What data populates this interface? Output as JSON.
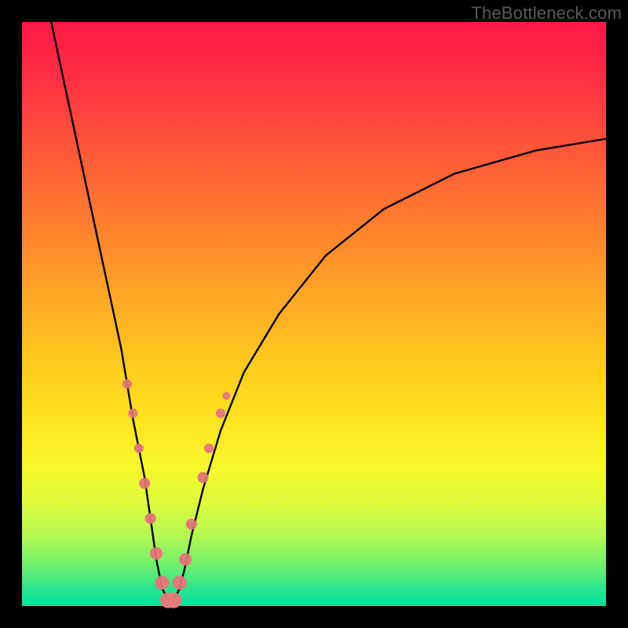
{
  "watermark": "TheBottleneck.com",
  "colors": {
    "frame": "#000000",
    "marker": "#e37a7a",
    "curve": "#000000"
  },
  "chart_data": {
    "type": "line",
    "title": "",
    "xlabel": "",
    "ylabel": "",
    "xlim": [
      0,
      100
    ],
    "ylim": [
      0,
      100
    ],
    "minimum_at_x": 25,
    "series": [
      {
        "name": "bottleneck-curve",
        "x": [
          5,
          8,
          11,
          14,
          17,
          19,
          21,
          22,
          23,
          24,
          25,
          26,
          27,
          28,
          29,
          31,
          34,
          38,
          44,
          52,
          62,
          74,
          88,
          100
        ],
        "y": [
          100,
          86,
          72,
          58,
          44,
          32,
          22,
          15,
          8,
          3,
          1,
          1,
          3,
          7,
          12,
          20,
          30,
          40,
          50,
          60,
          68,
          74,
          78,
          80
        ]
      }
    ],
    "markers": {
      "name": "highlighted-points",
      "radius_px_range": [
        4,
        10
      ],
      "points": [
        {
          "x": 18,
          "y": 38,
          "r": 6
        },
        {
          "x": 19,
          "y": 33,
          "r": 6
        },
        {
          "x": 20,
          "y": 27,
          "r": 6
        },
        {
          "x": 21,
          "y": 21,
          "r": 7
        },
        {
          "x": 22,
          "y": 15,
          "r": 7
        },
        {
          "x": 23,
          "y": 9,
          "r": 8
        },
        {
          "x": 24,
          "y": 4,
          "r": 9
        },
        {
          "x": 25,
          "y": 1,
          "r": 10
        },
        {
          "x": 26,
          "y": 1,
          "r": 10
        },
        {
          "x": 27,
          "y": 4,
          "r": 9
        },
        {
          "x": 28,
          "y": 8,
          "r": 8
        },
        {
          "x": 29,
          "y": 14,
          "r": 7
        },
        {
          "x": 31,
          "y": 22,
          "r": 7
        },
        {
          "x": 32,
          "y": 27,
          "r": 6
        },
        {
          "x": 34,
          "y": 33,
          "r": 6
        },
        {
          "x": 35,
          "y": 36,
          "r": 5
        }
      ]
    }
  }
}
